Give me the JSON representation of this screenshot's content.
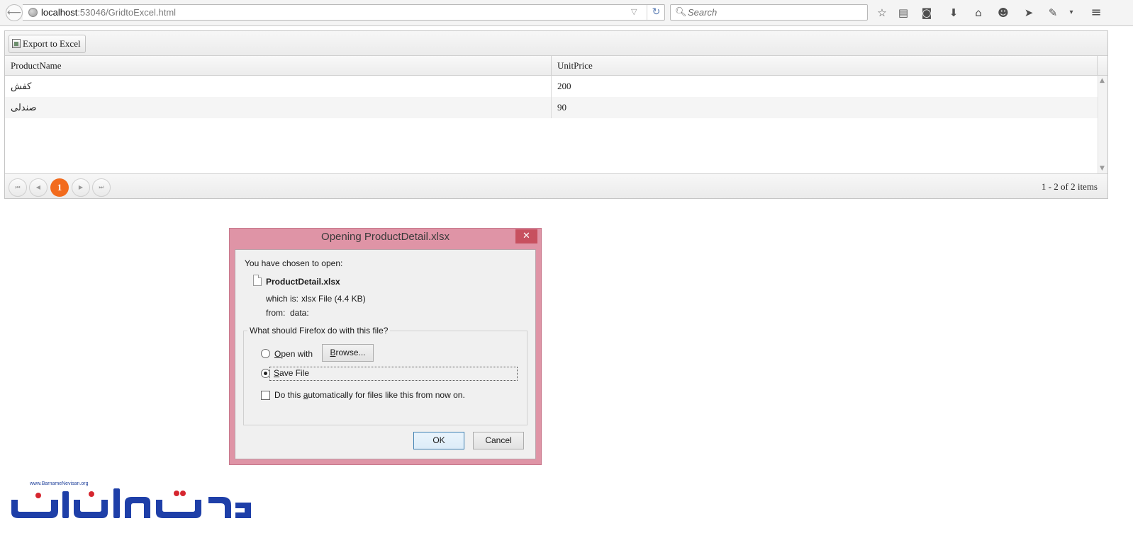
{
  "browser": {
    "url_host": "localhost",
    "url_rest": ":53046/GridtoExcel.html",
    "search_placeholder": "Search"
  },
  "grid": {
    "toolbar": {
      "export_label": "Export to Excel"
    },
    "columns": [
      "ProductName",
      "UnitPrice"
    ],
    "rows": [
      {
        "name": "کفش",
        "price": "200"
      },
      {
        "name": "صندلی",
        "price": "90"
      }
    ],
    "pager": {
      "current_page": "1",
      "info": "1 - 2 of 2 items"
    }
  },
  "dialog": {
    "title": "Opening ProductDetail.xlsx",
    "close_symbol": "✕",
    "chosen_text": "You have chosen to open:",
    "file_name": "ProductDetail.xlsx",
    "which_is_label": "which is:",
    "which_is_value": "xlsx File (4.4 KB)",
    "from_label": "from:",
    "from_value": "data:",
    "question": "What should Firefox do with this file?",
    "open_with_first": "O",
    "open_with_rest": "pen with",
    "browse_first": "B",
    "browse_rest": "rowse...",
    "save_first": "S",
    "save_rest": "ave File",
    "auto_before": "Do this ",
    "auto_underline": "a",
    "auto_after": "utomatically for files like this from now on.",
    "selected_option": "save_file",
    "auto_checked": false,
    "ok_label": "OK",
    "cancel_label": "Cancel"
  },
  "watermark": {
    "url": "www.BarnameNevisan.org",
    "brand_color": "#1e3fa8",
    "accent_color": "#d6262f"
  },
  "colors": {
    "pager_current": "#f26b1d",
    "dialog_frame": "#df94a6",
    "dialog_close": "#c7505f"
  }
}
